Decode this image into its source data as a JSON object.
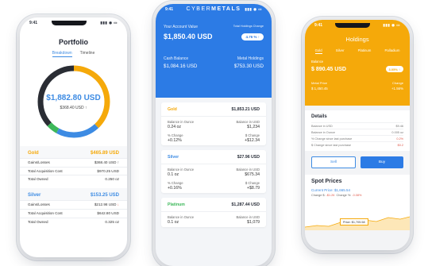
{
  "portfolio": {
    "time": "9:41",
    "title": "Portfolio",
    "tabs": [
      "Breakdown",
      "Timeline"
    ],
    "total": "$1,882.80 USD",
    "gain": "$368.40 USD",
    "segments": [
      {
        "color": "#f5a90a",
        "fraction": 0.38
      },
      {
        "color": "#3d8be3",
        "fraction": 0.2
      },
      {
        "color": "#3db85a",
        "fraction": 0.05
      },
      {
        "color": "#2a2d34",
        "fraction": 0.37
      }
    ],
    "gold": {
      "name": "Gold",
      "value": "$465.89 USD",
      "rows": [
        {
          "label": "Gains/Losses",
          "value": "$368.40 USD"
        },
        {
          "label": "Total Acquisition Cost",
          "value": "$970.25 USD"
        },
        {
          "label": "Total Owned",
          "value": "0.250 oz"
        }
      ]
    },
    "silver": {
      "name": "Silver",
      "value": "$153.25 USD",
      "rows": [
        {
          "label": "Gains/Losses",
          "value": "$212.98 USD"
        },
        {
          "label": "Total Acquisition Cost",
          "value": "$642.80 USD"
        },
        {
          "label": "Total Owned",
          "value": "0.325 oz"
        }
      ]
    }
  },
  "cybermetals": {
    "time": "9:41",
    "logo_a": "CYBER",
    "logo_b": "METALS",
    "account_label": "Your Account Value",
    "account_value": "$1,850.40 USD",
    "change_label": "Total Holdings Change",
    "change_pill": "4.76 % ↑",
    "cash_label": "Cash Balance",
    "cash_value": "$1,084.16 USD",
    "metal_label": "Metal Holdings",
    "metal_value": "$753.30 USD",
    "cards": [
      {
        "name": "Gold",
        "color": "#f5a90a",
        "total": "$1,853.21 USD",
        "bal_oz": "0.24 oz",
        "bal_usd": "$1,234",
        "pct": "+0.12%",
        "chg": "+$12.34"
      },
      {
        "name": "Silver",
        "color": "#3d8be3",
        "total": "$27.96 USD",
        "bal_oz": "0.1 oz",
        "bal_usd": "$675.34",
        "pct": "+0.16%",
        "chg": "+$8.79"
      },
      {
        "name": "Platinum",
        "color": "#3db85a",
        "total": "$1,287.44 USD",
        "bal_oz": "0.1 oz",
        "bal_usd": "$1,079",
        "pct": "",
        "chg": ""
      }
    ],
    "labels": {
      "bal_oz": "Balance in Ounce",
      "bal_usd": "Balance in USD",
      "pct": "% Change",
      "chg": "$ Change"
    }
  },
  "holdings": {
    "time": "9:41",
    "title": "Holdings",
    "tabs": [
      "Gold",
      "Silver",
      "Platinum",
      "Palladium"
    ],
    "balance_label": "Balance",
    "balance_value": "$ 890.45 USD",
    "pill": "3.05% ↑",
    "metal_price_label": "Metal Price",
    "metal_price_value": "$ 1,450.45",
    "change_label": "Change",
    "change_value": "+1.56%",
    "details_title": "Details",
    "details": [
      {
        "label": "Balance in USD",
        "value": "$9.46"
      },
      {
        "label": "Balance in Ounce",
        "value": "0.005 oz"
      },
      {
        "label": "% Change since last purchase",
        "value": "0.2%"
      },
      {
        "label": "$ Change since last purchase",
        "value": "$0.2"
      }
    ],
    "sell": "Sell",
    "buy": "Buy",
    "spot_title": "Spot Prices",
    "spot_price": "Current Price: $1,665.54",
    "spot_change_a": "Change $: ",
    "spot_change_a_v": "-$1.26",
    "spot_change_b": "Change %: ",
    "spot_change_b_v": "-0.08%",
    "tooltip": "Price: $1,705.58"
  }
}
